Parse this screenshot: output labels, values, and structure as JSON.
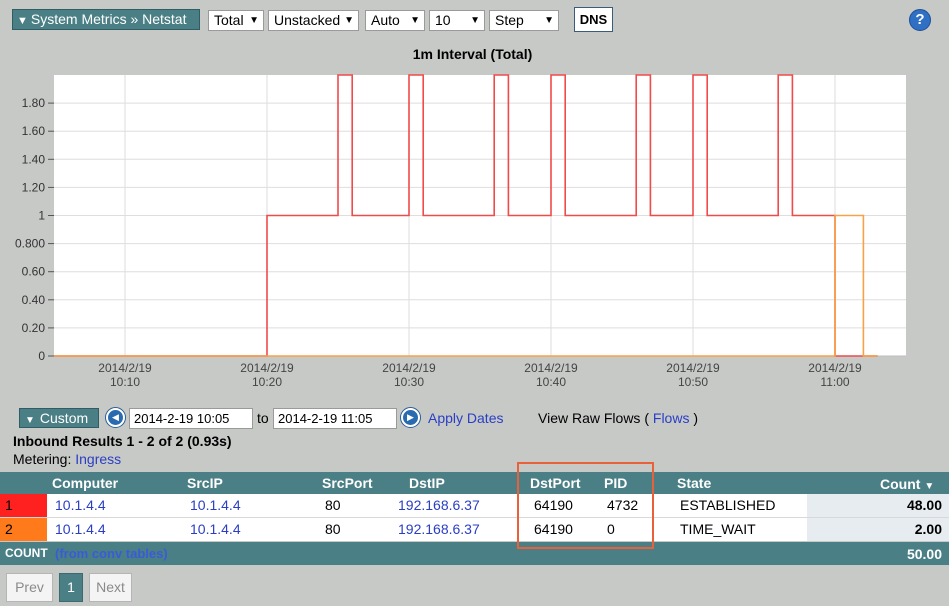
{
  "toolbar": {
    "breadcrumb": "System Metrics » Netstat",
    "selects": [
      "Total",
      "Unstacked",
      "Auto",
      "10",
      "Step"
    ],
    "dns_label": "DNS",
    "help_label": "?"
  },
  "chart_data": {
    "type": "line",
    "title": "1m Interval (Total)",
    "xlabel": "",
    "ylabel": "",
    "x_ticks": [
      {
        "date": "2014/2/19",
        "time": "10:10"
      },
      {
        "date": "2014/2/19",
        "time": "10:20"
      },
      {
        "date": "2014/2/19",
        "time": "10:30"
      },
      {
        "date": "2014/2/19",
        "time": "10:40"
      },
      {
        "date": "2014/2/19",
        "time": "10:50"
      },
      {
        "date": "2014/2/19",
        "time": "11:00"
      }
    ],
    "y_ticks": [
      "0",
      "0.20",
      "0.40",
      "0.60",
      "0.800",
      "1",
      "1.20",
      "1.40",
      "1.60",
      "1.80"
    ],
    "ylim": [
      0,
      2
    ],
    "xlim": [
      "10:05",
      "11:05"
    ],
    "grid": true,
    "interpolation": "step",
    "series": [
      {
        "color": "#f04a4a",
        "points": [
          [
            "10:05",
            0
          ],
          [
            "10:20",
            1
          ],
          [
            "10:25",
            2
          ],
          [
            "10:26",
            1
          ],
          [
            "10:30",
            2
          ],
          [
            "10:31",
            1
          ],
          [
            "10:36",
            2
          ],
          [
            "10:37",
            1
          ],
          [
            "10:40",
            2
          ],
          [
            "10:41",
            1
          ],
          [
            "10:46",
            2
          ],
          [
            "10:47",
            1
          ],
          [
            "10:50",
            2
          ],
          [
            "10:51",
            1
          ],
          [
            "10:56",
            2
          ],
          [
            "10:57",
            1
          ],
          [
            "11:00",
            0
          ],
          [
            "11:03",
            0
          ]
        ]
      },
      {
        "color": "#f7a24a",
        "points": [
          [
            "10:05",
            0
          ],
          [
            "11:00",
            1
          ],
          [
            "11:02",
            0
          ],
          [
            "11:03",
            0
          ]
        ]
      }
    ]
  },
  "date_range": {
    "mode_label": "Custom",
    "from": "2014-2-19 10:05",
    "to_label": "to",
    "to": "2014-2-19 11:05",
    "apply_label": "Apply Dates",
    "raw_prefix": "View Raw Flows (",
    "raw_link": "Flows",
    "raw_suffix": ")"
  },
  "results": {
    "title": "Inbound Results 1 - 2 of 2 (0.93s)",
    "metering_label": "Metering:",
    "metering_value": "Ingress"
  },
  "table": {
    "columns": [
      "Computer",
      "SrcIP",
      "SrcPort",
      "DstIP",
      "DstPort",
      "PID",
      "State",
      "Count"
    ],
    "rows": [
      {
        "idx": "1",
        "color": "#ff2020",
        "computer": "10.1.4.4",
        "srcip": "10.1.4.4",
        "srcport": "80",
        "dstip": "192.168.6.37",
        "dstport": "64190",
        "pid": "4732",
        "state": "ESTABLISHED",
        "count": "48.00"
      },
      {
        "idx": "2",
        "color": "#ff7a1a",
        "computer": "10.1.4.4",
        "srcip": "10.1.4.4",
        "srcport": "80",
        "dstip": "192.168.6.37",
        "dstport": "64190",
        "pid": "0",
        "state": "TIME_WAIT",
        "count": "2.00"
      }
    ],
    "footer_label": "COUNT",
    "footer_conv": "(from conv tables)",
    "footer_total": "50.00"
  },
  "pager": {
    "prev": "Prev",
    "current": "1",
    "next": "Next"
  },
  "colors": {
    "accent": "#4b7f86",
    "highlight": "#e8613a",
    "link": "#2a3ec4"
  }
}
